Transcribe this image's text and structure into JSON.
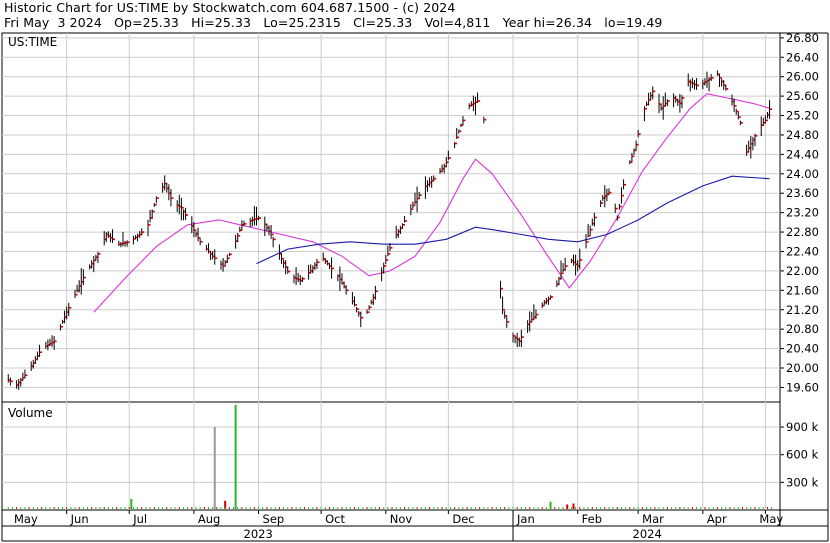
{
  "header": {
    "line1": "Historic Chart for US:TIME by Stockwatch.com 604.687.1500 - (c) 2024",
    "line2": "Fri May  3 2024   Op=25.33   Hi=25.33   Lo=25.2315   Cl=25.33   Vol=4,811   Year hi=26.34   lo=19.49"
  },
  "colors": {
    "price_bar": "#000000",
    "close_tick": "#cc0000",
    "ma_short": "#dd33dd",
    "ma_long": "#1a1aaa",
    "volume_up": "#22bb22",
    "volume_down": "#cc0000",
    "volume_neutral": "#999999",
    "grid": "#cccccc"
  },
  "chart_data": [
    {
      "type": "ohlc",
      "symbol_label": "US:TIME",
      "ylim": [
        19.3,
        26.9
      ],
      "y_ticks": [
        "26.80",
        "26.40",
        "26.00",
        "25.60",
        "25.20",
        "24.80",
        "24.40",
        "24.00",
        "23.60",
        "23.20",
        "22.80",
        "22.40",
        "22.00",
        "21.60",
        "21.20",
        "20.80",
        "20.40",
        "20.00",
        "19.60"
      ],
      "grid": true,
      "x_month_labels": [
        "May",
        "Jun",
        "Jul",
        "Aug",
        "Sep",
        "Oct",
        "Nov",
        "Dec",
        "Jan",
        "Feb",
        "Mar",
        "Apr",
        "May"
      ],
      "x_year_labels": [
        "2023",
        "2024"
      ],
      "close_anchors": [
        [
          "2023-05-04",
          19.75
        ],
        [
          "2023-05-08",
          19.65
        ],
        [
          "2023-05-12",
          19.85
        ],
        [
          "2023-05-16",
          20.1
        ],
        [
          "2023-05-20",
          20.4
        ],
        [
          "2023-05-26",
          20.55
        ],
        [
          "2023-06-01",
          21.15
        ],
        [
          "2023-06-06",
          21.6
        ],
        [
          "2023-06-10",
          21.95
        ],
        [
          "2023-06-16",
          22.35
        ],
        [
          "2023-06-20",
          22.75
        ],
        [
          "2023-06-26",
          22.55
        ],
        [
          "2023-07-01",
          22.6
        ],
        [
          "2023-07-06",
          22.75
        ],
        [
          "2023-07-10",
          22.95
        ],
        [
          "2023-07-14",
          23.5
        ],
        [
          "2023-07-18",
          23.8
        ],
        [
          "2023-07-22",
          23.4
        ],
        [
          "2023-07-26",
          23.3
        ],
        [
          "2023-07-30",
          23.0
        ],
        [
          "2023-08-04",
          22.6
        ],
        [
          "2023-08-10",
          22.3
        ],
        [
          "2023-08-15",
          22.1
        ],
        [
          "2023-08-20",
          22.5
        ],
        [
          "2023-08-24",
          22.95
        ],
        [
          "2023-08-29",
          23.05
        ],
        [
          "2023-09-02",
          23.1
        ],
        [
          "2023-09-07",
          22.75
        ],
        [
          "2023-09-12",
          22.25
        ],
        [
          "2023-09-16",
          21.9
        ],
        [
          "2023-09-21",
          21.8
        ],
        [
          "2023-09-26",
          22.0
        ],
        [
          "2023-10-01",
          22.3
        ],
        [
          "2023-10-05",
          22.1
        ],
        [
          "2023-10-09",
          21.9
        ],
        [
          "2023-10-13",
          21.6
        ],
        [
          "2023-10-17",
          21.3
        ],
        [
          "2023-10-21",
          20.95
        ],
        [
          "2023-10-26",
          21.45
        ],
        [
          "2023-10-31",
          22.1
        ],
        [
          "2023-11-04",
          22.6
        ],
        [
          "2023-11-09",
          22.95
        ],
        [
          "2023-11-14",
          23.35
        ],
        [
          "2023-11-19",
          23.7
        ],
        [
          "2023-11-24",
          23.9
        ],
        [
          "2023-11-29",
          24.15
        ],
        [
          "2023-12-03",
          24.5
        ],
        [
          "2023-12-07",
          25.0
        ],
        [
          "2023-12-11",
          25.4
        ],
        [
          "2023-12-15",
          25.5
        ],
        [
          "2023-12-17",
          25.55
        ],
        [
          "2023-12-27",
          21.2
        ],
        [
          "2023-12-31",
          20.7
        ],
        [
          "2024-01-04",
          20.55
        ],
        [
          "2024-01-08",
          20.9
        ],
        [
          "2024-01-12",
          21.1
        ],
        [
          "2024-01-16",
          21.35
        ],
        [
          "2024-01-20",
          21.5
        ],
        [
          "2024-01-24",
          21.95
        ],
        [
          "2024-01-28",
          22.25
        ],
        [
          "2024-02-01",
          22.1
        ],
        [
          "2024-02-05",
          22.6
        ],
        [
          "2024-02-09",
          23.1
        ],
        [
          "2024-02-13",
          23.5
        ],
        [
          "2024-02-17",
          23.65
        ],
        [
          "2024-02-20",
          23.1
        ],
        [
          "2024-02-24",
          24.0
        ],
        [
          "2024-02-29",
          24.6
        ],
        [
          "2024-03-03",
          25.25
        ],
        [
          "2024-03-08",
          25.7
        ],
        [
          "2024-03-12",
          25.35
        ],
        [
          "2024-03-17",
          25.6
        ],
        [
          "2024-03-21",
          25.45
        ],
        [
          "2024-03-25",
          25.9
        ],
        [
          "2024-03-30",
          25.8
        ],
        [
          "2024-04-04",
          25.95
        ],
        [
          "2024-04-08",
          26.05
        ],
        [
          "2024-04-12",
          25.75
        ],
        [
          "2024-04-16",
          25.4
        ],
        [
          "2024-04-19",
          25.05
        ],
        [
          "2024-04-22",
          24.45
        ],
        [
          "2024-04-25",
          24.7
        ],
        [
          "2024-04-28",
          24.95
        ],
        [
          "2024-05-01",
          25.1
        ],
        [
          "2024-05-03",
          25.33
        ]
      ],
      "ma_short_anchors": [
        [
          "2023-06-14",
          21.15
        ],
        [
          "2023-06-29",
          21.85
        ],
        [
          "2023-07-14",
          22.5
        ],
        [
          "2023-07-29",
          22.95
        ],
        [
          "2023-08-13",
          23.05
        ],
        [
          "2023-08-28",
          22.9
        ],
        [
          "2023-09-12",
          22.75
        ],
        [
          "2023-09-27",
          22.6
        ],
        [
          "2023-10-11",
          22.3
        ],
        [
          "2023-10-24",
          21.9
        ],
        [
          "2023-11-03",
          22.0
        ],
        [
          "2023-11-15",
          22.3
        ],
        [
          "2023-11-27",
          23.0
        ],
        [
          "2023-12-08",
          23.9
        ],
        [
          "2023-12-14",
          24.3
        ],
        [
          "2023-12-22",
          24.0
        ],
        [
          "2024-01-05",
          23.15
        ],
        [
          "2024-01-17",
          22.35
        ],
        [
          "2024-01-28",
          21.65
        ],
        [
          "2024-02-07",
          22.2
        ],
        [
          "2024-02-20",
          23.1
        ],
        [
          "2024-03-03",
          24.05
        ],
        [
          "2024-03-14",
          24.7
        ],
        [
          "2024-03-26",
          25.35
        ],
        [
          "2024-04-03",
          25.65
        ],
        [
          "2024-04-14",
          25.55
        ],
        [
          "2024-04-25",
          25.45
        ],
        [
          "2024-05-03",
          25.35
        ]
      ],
      "ma_long_anchors": [
        [
          "2023-08-31",
          22.15
        ],
        [
          "2023-09-15",
          22.45
        ],
        [
          "2023-09-30",
          22.55
        ],
        [
          "2023-10-15",
          22.6
        ],
        [
          "2023-10-31",
          22.55
        ],
        [
          "2023-11-15",
          22.55
        ],
        [
          "2023-11-30",
          22.65
        ],
        [
          "2023-12-14",
          22.9
        ],
        [
          "2023-12-22",
          22.85
        ],
        [
          "2024-01-05",
          22.75
        ],
        [
          "2024-01-18",
          22.65
        ],
        [
          "2024-02-01",
          22.6
        ],
        [
          "2024-02-15",
          22.75
        ],
        [
          "2024-03-01",
          23.05
        ],
        [
          "2024-03-15",
          23.4
        ],
        [
          "2024-04-01",
          23.75
        ],
        [
          "2024-04-15",
          23.95
        ],
        [
          "2024-05-03",
          23.9
        ]
      ]
    },
    {
      "type": "bar",
      "title": "Volume",
      "ylim": [
        0,
        1150000
      ],
      "y_ticks": [
        {
          "value": 900000,
          "label": "900 k"
        },
        {
          "value": 600000,
          "label": "600 k"
        },
        {
          "value": 300000,
          "label": "300 k"
        }
      ],
      "spikes": [
        {
          "date": "2023-07-02",
          "value": 120000,
          "kind": "up"
        },
        {
          "date": "2023-08-11",
          "value": 900000,
          "kind": "neutral"
        },
        {
          "date": "2023-08-16",
          "value": 100000,
          "kind": "down"
        },
        {
          "date": "2023-08-21",
          "value": 1140000,
          "kind": "up"
        },
        {
          "date": "2024-01-19",
          "value": 90000,
          "kind": "up"
        },
        {
          "date": "2024-01-27",
          "value": 60000,
          "kind": "down"
        },
        {
          "date": "2024-01-30",
          "value": 70000,
          "kind": "down"
        }
      ]
    }
  ]
}
